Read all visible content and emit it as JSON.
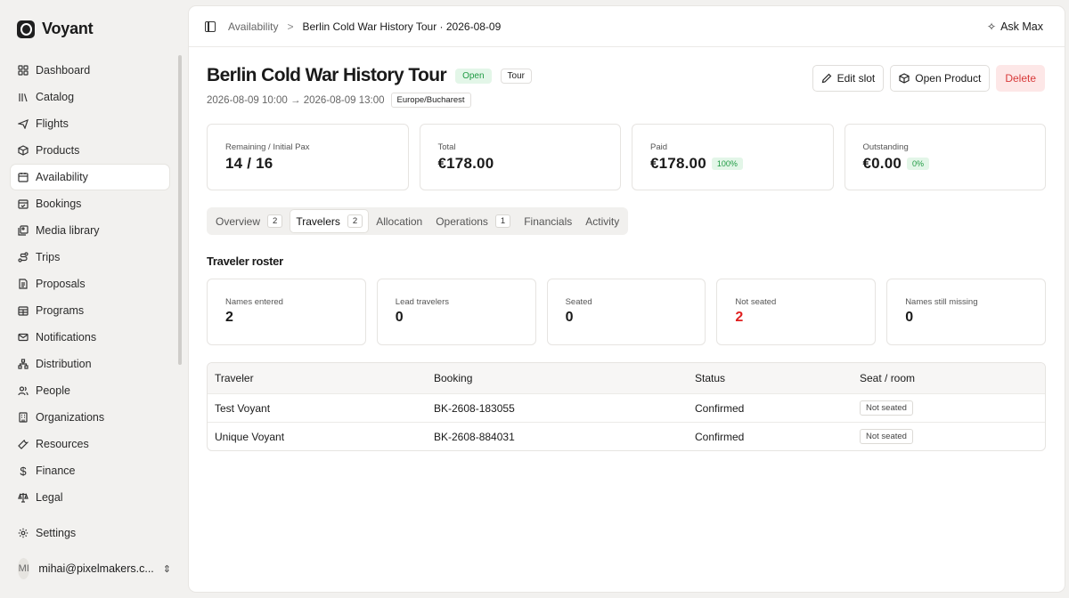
{
  "app": {
    "name": "Voyant"
  },
  "sidebar": {
    "items": [
      {
        "label": "Dashboard",
        "icon": "dashboard-icon"
      },
      {
        "label": "Catalog",
        "icon": "library-icon"
      },
      {
        "label": "Flights",
        "icon": "plane-icon"
      },
      {
        "label": "Products",
        "icon": "package-icon"
      },
      {
        "label": "Availability",
        "icon": "calendar-icon"
      },
      {
        "label": "Bookings",
        "icon": "calendar-check-icon"
      },
      {
        "label": "Media library",
        "icon": "images-icon"
      },
      {
        "label": "Trips",
        "icon": "route-icon"
      },
      {
        "label": "Proposals",
        "icon": "file-text-icon"
      },
      {
        "label": "Programs",
        "icon": "calendar-grid-icon"
      },
      {
        "label": "Notifications",
        "icon": "mail-icon"
      },
      {
        "label": "Distribution",
        "icon": "network-icon"
      },
      {
        "label": "People",
        "icon": "users-icon"
      },
      {
        "label": "Organizations",
        "icon": "building-icon"
      },
      {
        "label": "Resources",
        "icon": "wrench-icon"
      },
      {
        "label": "Finance",
        "icon": "dollar-icon"
      },
      {
        "label": "Legal",
        "icon": "scale-icon"
      }
    ],
    "settings": "Settings",
    "user": {
      "initials": "MI",
      "email": "mihai@pixelmakers.c..."
    }
  },
  "topbar": {
    "crumb_parent": "Availability",
    "crumb_separator": ">",
    "crumb_current": "Berlin Cold War History Tour · 2026-08-09",
    "ask_label": "Ask Max"
  },
  "header": {
    "title": "Berlin Cold War History Tour",
    "status_badge": "Open",
    "type_badge": "Tour",
    "date_range": "2026-08-09 10:00 → 2026-08-09 13:00",
    "timezone": "Europe/Bucharest"
  },
  "actions": {
    "edit": "Edit slot",
    "open_product": "Open Product",
    "delete": "Delete"
  },
  "stats": {
    "remaining": {
      "label": "Remaining / Initial Pax",
      "value": "14 / 16"
    },
    "total": {
      "label": "Total",
      "value": "€178.00"
    },
    "paid": {
      "label": "Paid",
      "value": "€178.00",
      "pct": "100%"
    },
    "outstanding": {
      "label": "Outstanding",
      "value": "€0.00",
      "pct": "0%"
    }
  },
  "tabs": [
    {
      "label": "Overview",
      "count": "2"
    },
    {
      "label": "Travelers",
      "count": "2"
    },
    {
      "label": "Allocation",
      "count": ""
    },
    {
      "label": "Operations",
      "count": "1"
    },
    {
      "label": "Financials",
      "count": ""
    },
    {
      "label": "Activity",
      "count": ""
    }
  ],
  "roster": {
    "title": "Traveler roster",
    "cards": [
      {
        "label": "Names entered",
        "value": "2"
      },
      {
        "label": "Lead travelers",
        "value": "0"
      },
      {
        "label": "Seated",
        "value": "0"
      },
      {
        "label": "Not seated",
        "value": "2"
      },
      {
        "label": "Names still missing",
        "value": "0"
      }
    ]
  },
  "table": {
    "headers": [
      "Traveler",
      "Booking",
      "Status",
      "Seat / room"
    ],
    "rows": [
      {
        "traveler": "Test Voyant",
        "booking": "BK-2608-183055",
        "status": "Confirmed",
        "seat": "Not seated"
      },
      {
        "traveler": "Unique Voyant",
        "booking": "BK-2608-884031",
        "status": "Confirmed",
        "seat": "Not seated"
      }
    ]
  }
}
